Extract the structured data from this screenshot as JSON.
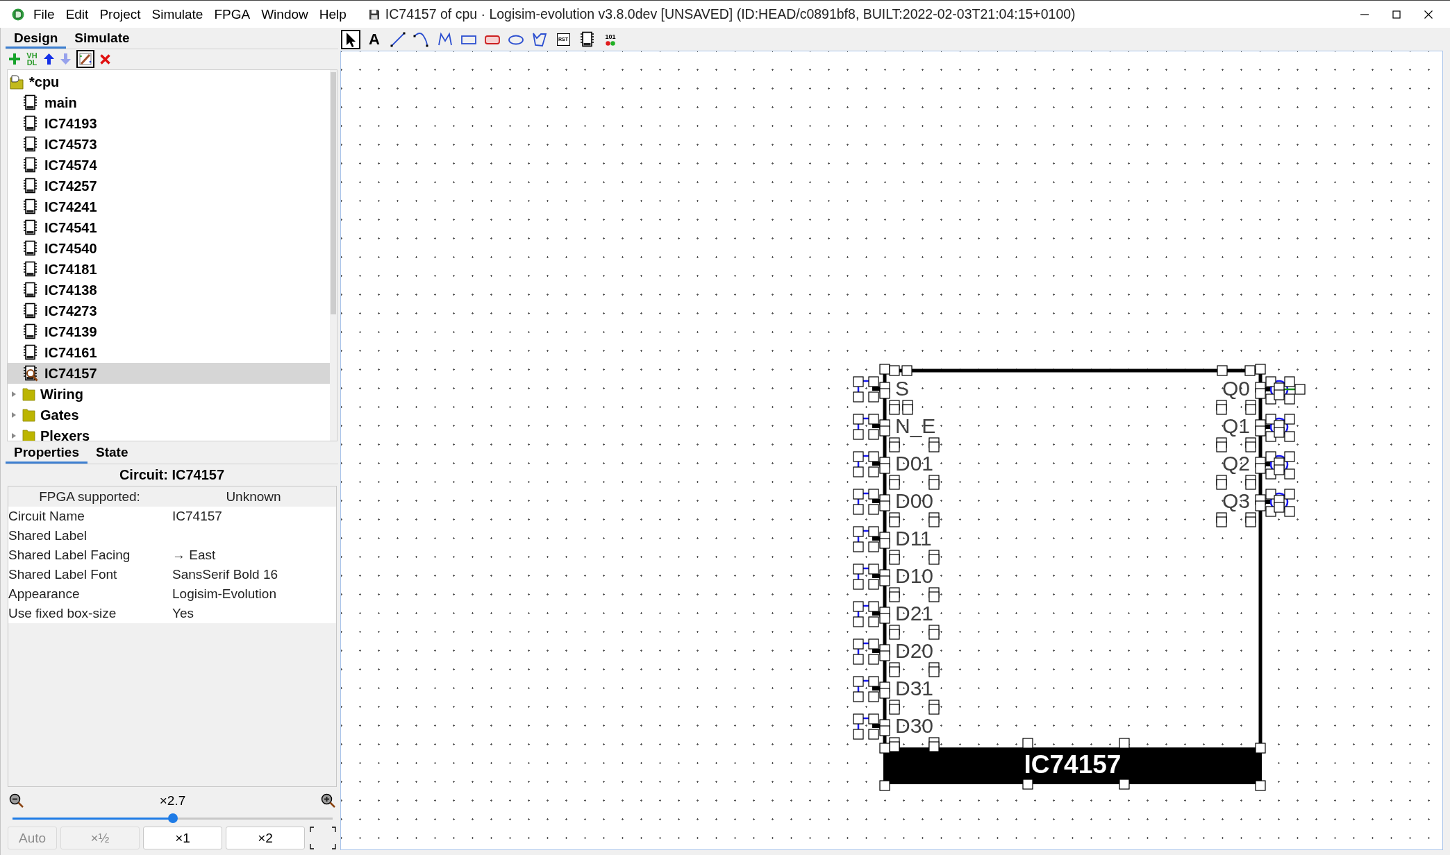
{
  "window": {
    "title": "IC74157 of cpu · Logisim-evolution v3.8.0dev [UNSAVED] (ID:HEAD/c0891bf8, BUILT:2022-02-03T21:04:15+0100)"
  },
  "menu": [
    "File",
    "Edit",
    "Project",
    "Simulate",
    "FPGA",
    "Window",
    "Help"
  ],
  "explorer": {
    "tabs": [
      {
        "label": "Design",
        "selected": true
      },
      {
        "label": "Simulate",
        "selected": false
      }
    ],
    "toolbar": [
      {
        "kind": "add",
        "disabled": false,
        "selected": false
      },
      {
        "kind": "vhdl",
        "text": "VH DL",
        "disabled": false,
        "selected": false
      },
      {
        "kind": "move_up",
        "disabled": false,
        "selected": false
      },
      {
        "kind": "move_down",
        "disabled": true,
        "selected": false
      },
      {
        "kind": "appearance",
        "disabled": false,
        "selected": true
      },
      {
        "kind": "delete",
        "disabled": false,
        "selected": false
      }
    ],
    "tree": [
      {
        "label": "*cpu",
        "kind": "project",
        "selected": false,
        "children": [
          {
            "label": "main",
            "kind": "circuit",
            "selected": false
          },
          {
            "label": "IC74193",
            "kind": "circuit",
            "selected": false
          },
          {
            "label": "IC74573",
            "kind": "circuit",
            "selected": false
          },
          {
            "label": "IC74574",
            "kind": "circuit",
            "selected": false
          },
          {
            "label": "IC74257",
            "kind": "circuit",
            "selected": false
          },
          {
            "label": "IC74241",
            "kind": "circuit",
            "selected": false
          },
          {
            "label": "IC74541",
            "kind": "circuit",
            "selected": false
          },
          {
            "label": "IC74540",
            "kind": "circuit",
            "selected": false
          },
          {
            "label": "IC74181",
            "kind": "circuit",
            "selected": false
          },
          {
            "label": "IC74138",
            "kind": "circuit",
            "selected": false
          },
          {
            "label": "IC74273",
            "kind": "circuit",
            "selected": false
          },
          {
            "label": "IC74139",
            "kind": "circuit",
            "selected": false
          },
          {
            "label": "IC74161",
            "kind": "circuit",
            "selected": false
          },
          {
            "label": "IC74157",
            "kind": "circuit",
            "selected": true
          }
        ]
      },
      {
        "label": "Wiring",
        "kind": "library",
        "expanded": false,
        "selected": false
      },
      {
        "label": "Gates",
        "kind": "library",
        "expanded": false,
        "selected": false
      },
      {
        "label": "Plexers",
        "kind": "library",
        "expanded": false,
        "selected": false
      }
    ]
  },
  "drawing_tools": [
    {
      "kind": "select",
      "selected": true
    },
    {
      "kind": "text",
      "glyph": "A",
      "selected": false
    },
    {
      "kind": "line",
      "selected": false
    },
    {
      "kind": "curve",
      "selected": false
    },
    {
      "kind": "polyline",
      "selected": false
    },
    {
      "kind": "rectangle",
      "selected": false
    },
    {
      "kind": "rounded_rectangle",
      "selected": false
    },
    {
      "kind": "oval",
      "selected": false
    },
    {
      "kind": "polygon",
      "selected": false
    },
    {
      "kind": "reset",
      "glyph": "RST",
      "selected": false
    },
    {
      "kind": "chip",
      "selected": false
    },
    {
      "kind": "port",
      "glyph": "101",
      "selected": false
    }
  ],
  "component": {
    "label": "IC74157",
    "inputs": [
      "S",
      "N_E",
      "D01",
      "D00",
      "D11",
      "D10",
      "D21",
      "D20",
      "D31",
      "D30"
    ],
    "outputs": [
      {
        "label": "Q0",
        "anchor": true
      },
      {
        "label": "Q1",
        "anchor": false
      },
      {
        "label": "Q2",
        "anchor": false
      },
      {
        "label": "Q3",
        "anchor": false
      }
    ]
  },
  "properties": {
    "tabs": [
      {
        "label": "Properties",
        "selected": true
      },
      {
        "label": "State",
        "selected": false
      }
    ],
    "title": "Circuit: IC74157",
    "header": {
      "label": "FPGA supported:",
      "value": "Unknown"
    },
    "rows": [
      {
        "label": "Circuit Name",
        "value": "IC74157"
      },
      {
        "label": "Shared Label"
      },
      {
        "label": "Shared Label Facing",
        "value": "→ East"
      },
      {
        "label": "Shared Label Font",
        "value": "SansSerif Bold 16"
      },
      {
        "label": "Appearance",
        "value": "Logisim-Evolution"
      },
      {
        "label": "Use fixed box-size",
        "value": "Yes"
      }
    ]
  },
  "zoom": {
    "reading": "×2.7",
    "level": 0.5,
    "buttons": [
      {
        "label": "Auto",
        "disabled": true
      },
      {
        "label": "×½",
        "disabled": true
      },
      {
        "label": "×1",
        "disabled": false
      },
      {
        "label": "×2",
        "disabled": false
      }
    ]
  }
}
